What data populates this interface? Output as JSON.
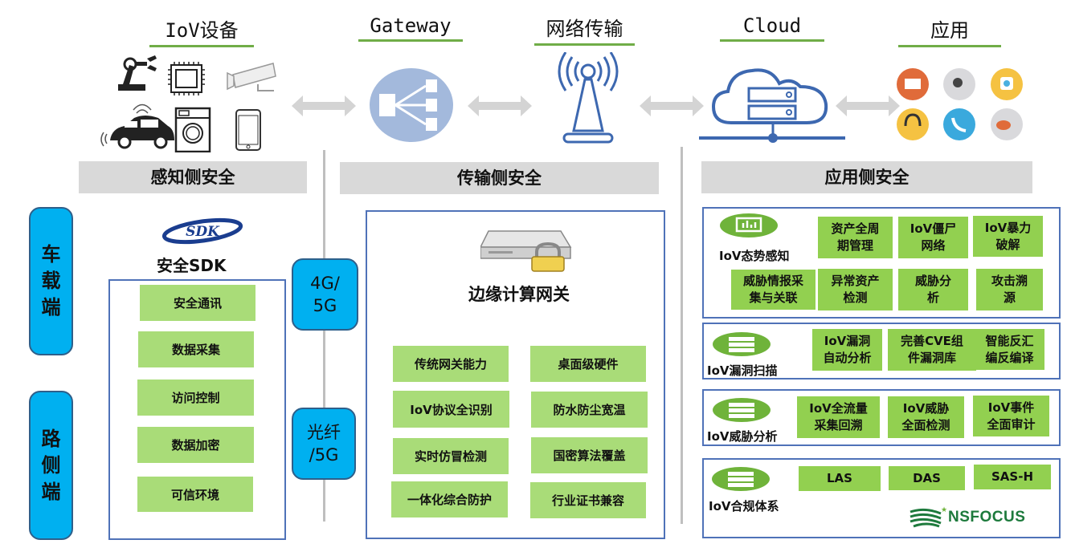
{
  "columns": [
    {
      "title": "IoV设备"
    },
    {
      "title": "Gateway"
    },
    {
      "title": "网络传输"
    },
    {
      "title": "Cloud"
    },
    {
      "title": "应用"
    }
  ],
  "sections": {
    "perception": "感知侧安全",
    "transport": "传输侧安全",
    "application": "应用侧安全"
  },
  "side_labels": {
    "vehicle": [
      "车",
      "载",
      "端"
    ],
    "roadside": [
      "路",
      "侧",
      "端"
    ]
  },
  "network_labels": {
    "cellular": [
      "4G/",
      "5G"
    ],
    "fiber": [
      "光纤",
      "/5G"
    ]
  },
  "sdk": {
    "logo_text": "SDK",
    "title": "安全SDK",
    "items": [
      "安全通讯",
      "数据采集",
      "访问控制",
      "数据加密",
      "可信环境"
    ]
  },
  "edge_gateway": {
    "title": "边缘计算网关",
    "left_items": [
      "传统网关能力",
      "IoV协议全识别",
      "实时仿冒检测",
      "一体化综合防护"
    ],
    "right_items": [
      "桌面级硬件",
      "防水防尘宽温",
      "国密算法覆盖",
      "行业证书兼容"
    ]
  },
  "app_panels": {
    "situation": {
      "label": "IoV态势感知",
      "items": [
        "资产全周\n期管理",
        "IoV僵尸\n网络",
        "IoV暴力\n破解",
        "威胁情报采\n集与关联",
        "异常资产\n检测",
        "威胁分\n析",
        "攻击溯\n源"
      ]
    },
    "vuln": {
      "label": "IoV漏洞扫描",
      "items": [
        "IoV漏洞\n自动分析",
        "完善CVE组\n件漏洞库",
        "智能反汇\n编反编译"
      ]
    },
    "threat": {
      "label": "IoV威胁分析",
      "items": [
        "IoV全流量\n采集回溯",
        "IoV威胁\n全面检测",
        "IoV事件\n全面审计"
      ]
    },
    "compliance": {
      "label": "IoV合规体系",
      "items": [
        "LAS",
        "DAS",
        "SAS-H"
      ]
    }
  },
  "brand": {
    "name": "NSFOCUS",
    "color": "#1d7a3c"
  },
  "colors": {
    "accent_green": "#70ad47",
    "box_green": "#92d050",
    "pill_blue": "#00b0f0",
    "panel_border": "#4f72b8",
    "header_gray": "#d9d9d9"
  }
}
